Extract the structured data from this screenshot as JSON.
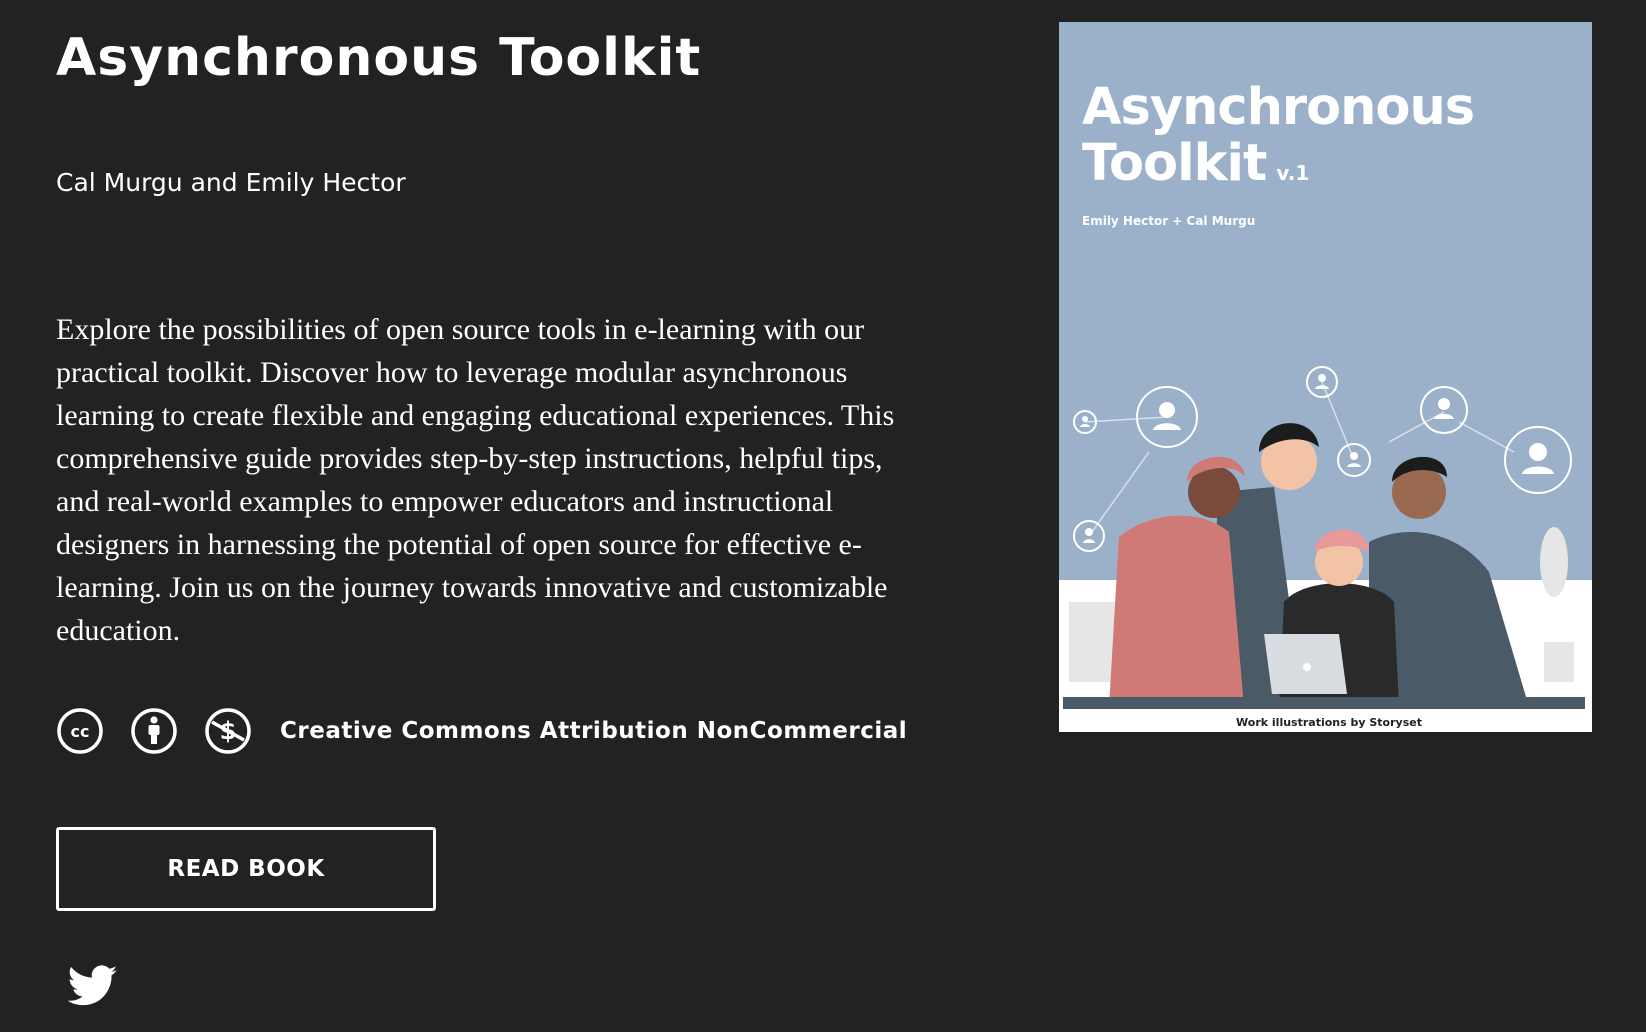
{
  "book": {
    "title": "Asynchronous Toolkit",
    "authors": "Cal Murgu and Emily Hector",
    "description": "Explore the possibilities of open source tools in e-learning with our practical toolkit. Discover how to leverage modular asynchronous learning to create flexible and engaging educational experiences. This comprehensive guide provides step-by-step instructions, helpful tips, and real-world examples to empower educators and instructional designers in harnessing the potential of open source for effective e-learning. Join us on the journey towards innovative and customizable education."
  },
  "license": {
    "icons": [
      "cc-icon",
      "attribution-icon",
      "noncommercial-icon"
    ],
    "label": "Creative Commons Attribution NonCommercial"
  },
  "actions": {
    "read_label": "READ BOOK",
    "share_icon": "twitter-icon"
  },
  "cover": {
    "title_line1": "Asynchronous",
    "title_line2": "Toolkit",
    "version": "v.1",
    "authors": "Emily Hector + Cal Murgu",
    "credit": "Work illustrations by Storyset"
  },
  "colors": {
    "background": "#222222",
    "text": "#ffffff",
    "cover_sky": "#9bb0c9"
  }
}
